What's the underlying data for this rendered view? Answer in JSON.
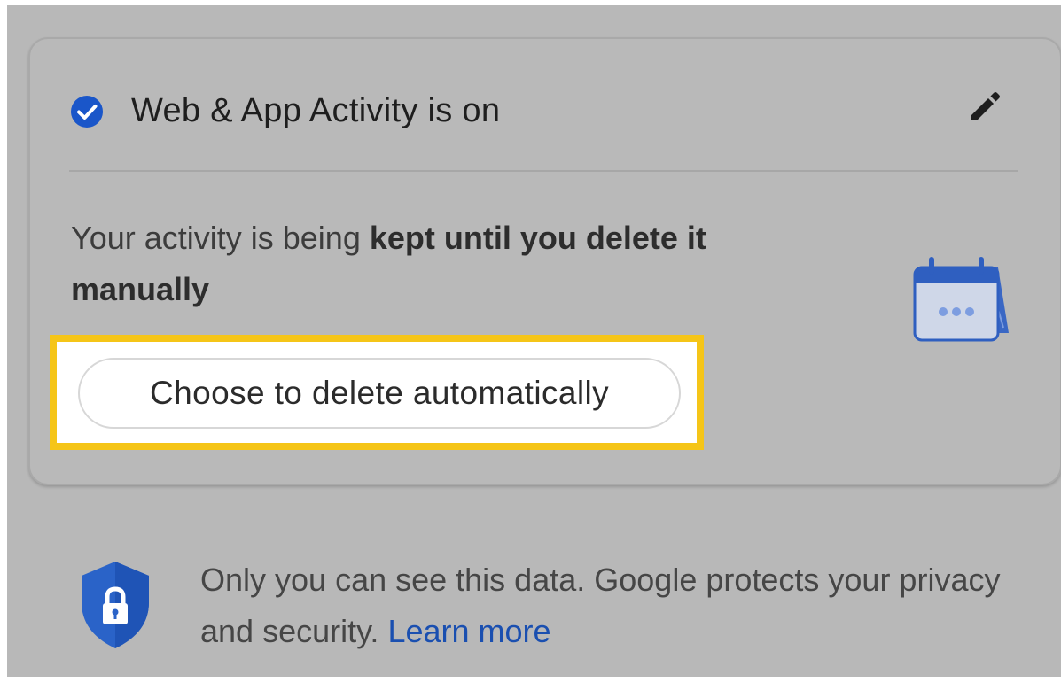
{
  "activity_card": {
    "status_title": "Web & App Activity is on",
    "description_prefix": "Your activity is being ",
    "description_bold": "kept until you delete it manually",
    "action_button_label": "Choose to delete automatically"
  },
  "privacy_note": {
    "text": "Only you can see this data. Google protects your privacy and security. ",
    "link_label": "Learn more"
  },
  "icons": {
    "check": "check-circle-icon",
    "edit": "pencil-icon",
    "calendar": "calendar-icon",
    "shield": "shield-lock-icon"
  },
  "colors": {
    "accent_blue": "#1a56c9",
    "highlight_yellow": "#f5c518",
    "link_blue": "#1a4fb0"
  }
}
